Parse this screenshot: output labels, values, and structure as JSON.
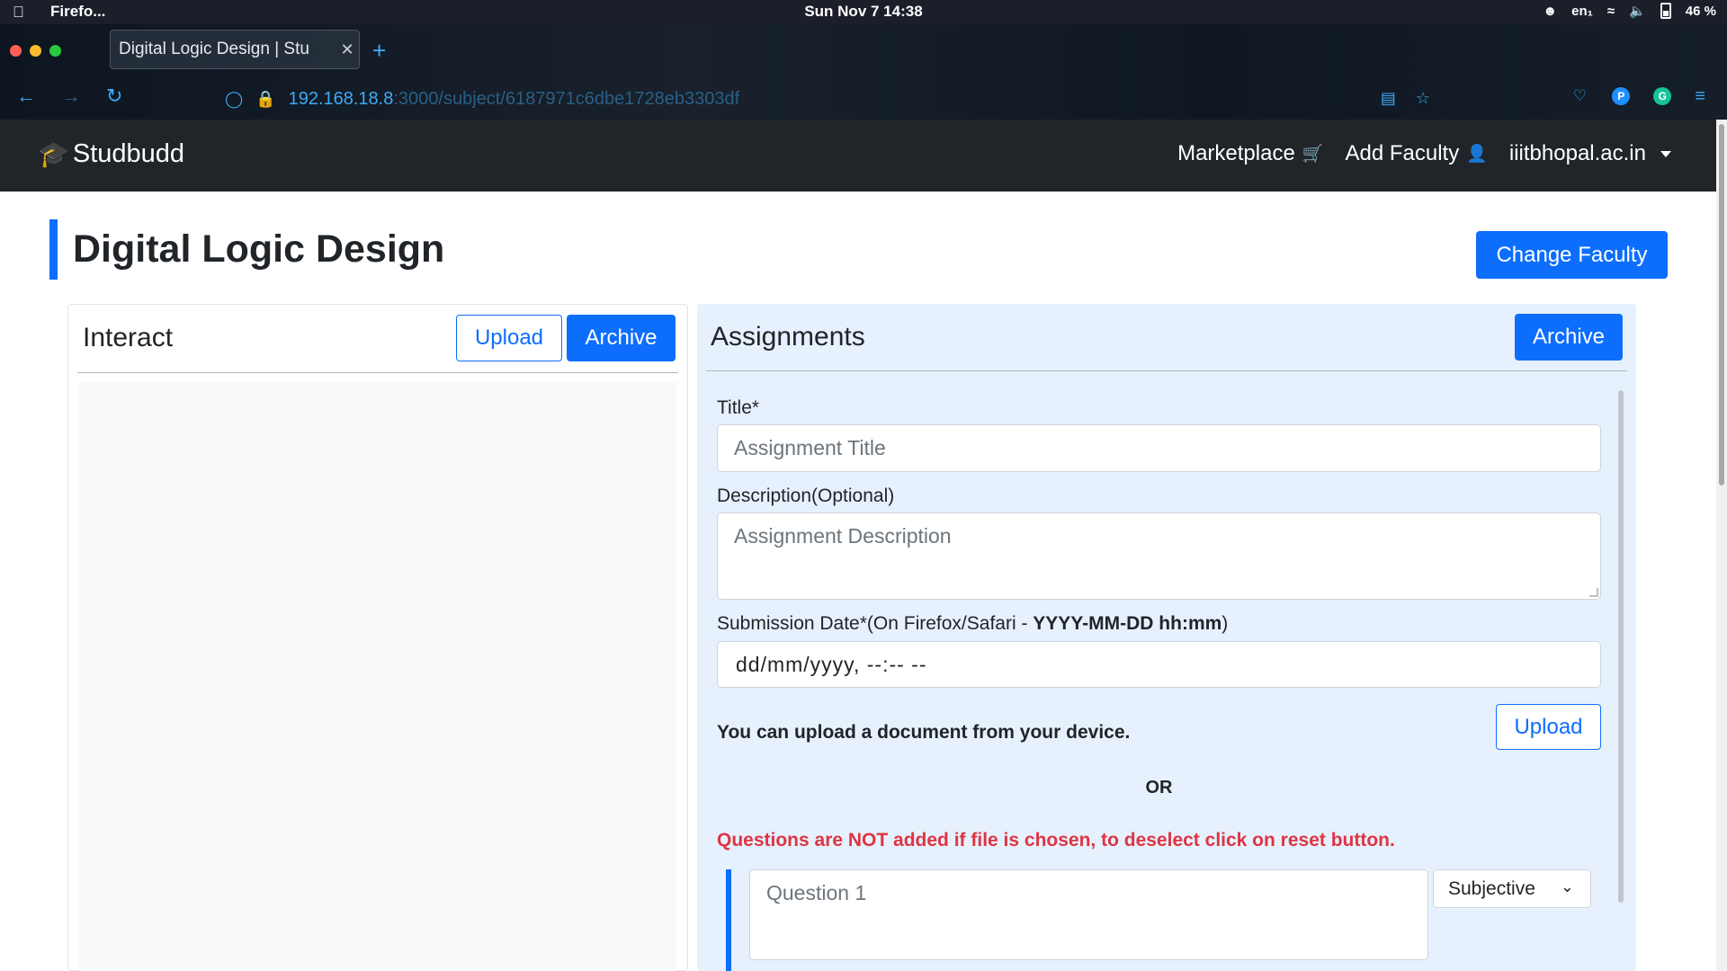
{
  "os": {
    "app_name": "Firefo...",
    "clock": "Sun Nov 7  14:38",
    "lang": "en₁",
    "battery": "46 %"
  },
  "browser": {
    "tab_title": "Digital Logic Design | Stu",
    "url_host": "192.168.18.8",
    "url_path": ":3000/subject/6187971c6dbe1728eb3303df"
  },
  "navbar": {
    "brand": "Studbudd",
    "links": {
      "marketplace": "Marketplace",
      "add_faculty": "Add Faculty",
      "institution": "iiitbhopal.ac.in"
    }
  },
  "page": {
    "title": "Digital Logic Design",
    "change_faculty": "Change Faculty"
  },
  "interact": {
    "title": "Interact",
    "upload": "Upload",
    "archive": "Archive"
  },
  "assignments": {
    "title": "Assignments",
    "archive": "Archive",
    "title_label": "Title*",
    "title_placeholder": "Assignment Title",
    "desc_label": "Description(Optional)",
    "desc_placeholder": "Assignment Description",
    "date_label_prefix": "Submission Date*(On Firefox/Safari - ",
    "date_label_bold": "YYYY-MM-DD hh:mm",
    "date_label_suffix": ")",
    "date_value": "dd/mm/yyyy, --:--  --",
    "upload_note": "You can upload a document from your device.",
    "upload": "Upload",
    "or": "OR",
    "warning": "Questions are NOT added if file is chosen, to deselect click on reset button.",
    "question_placeholder": "Question 1",
    "question_type": "Subjective"
  }
}
